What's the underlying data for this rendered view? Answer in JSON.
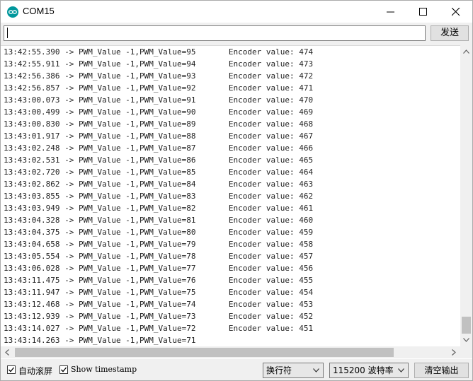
{
  "window": {
    "title": "COM15"
  },
  "send": {
    "input_value": "",
    "button_label": "发送"
  },
  "log_lines": [
    "13:42:55.390 -> PWM_Value -1,PWM_Value=95       Encoder value: 474",
    "13:42:55.911 -> PWM_Value -1,PWM_Value=94       Encoder value: 473",
    "13:42:56.386 -> PWM_Value -1,PWM_Value=93       Encoder value: 472",
    "13:42:56.857 -> PWM_Value -1,PWM_Value=92       Encoder value: 471",
    "13:43:00.073 -> PWM_Value -1,PWM_Value=91       Encoder value: 470",
    "13:43:00.499 -> PWM_Value -1,PWM_Value=90       Encoder value: 469",
    "13:43:00.830 -> PWM_Value -1,PWM_Value=89       Encoder value: 468",
    "13:43:01.917 -> PWM_Value -1,PWM_Value=88       Encoder value: 467",
    "13:43:02.248 -> PWM_Value -1,PWM_Value=87       Encoder value: 466",
    "13:43:02.531 -> PWM_Value -1,PWM_Value=86       Encoder value: 465",
    "13:43:02.720 -> PWM_Value -1,PWM_Value=85       Encoder value: 464",
    "13:43:02.862 -> PWM_Value -1,PWM_Value=84       Encoder value: 463",
    "13:43:03.855 -> PWM_Value -1,PWM_Value=83       Encoder value: 462",
    "13:43:03.949 -> PWM_Value -1,PWM_Value=82       Encoder value: 461",
    "13:43:04.328 -> PWM_Value -1,PWM_Value=81       Encoder value: 460",
    "13:43:04.375 -> PWM_Value -1,PWM_Value=80       Encoder value: 459",
    "13:43:04.658 -> PWM_Value -1,PWM_Value=79       Encoder value: 458",
    "13:43:05.554 -> PWM_Value -1,PWM_Value=78       Encoder value: 457",
    "13:43:06.028 -> PWM_Value -1,PWM_Value=77       Encoder value: 456",
    "13:43:11.475 -> PWM_Value -1,PWM_Value=76       Encoder value: 455",
    "13:43:11.947 -> PWM_Value -1,PWM_Value=75       Encoder value: 454",
    "13:43:12.468 -> PWM_Value -1,PWM_Value=74       Encoder value: 453",
    "13:43:12.939 -> PWM_Value -1,PWM_Value=73       Encoder value: 452",
    "13:43:14.027 -> PWM_Value -1,PWM_Value=72       Encoder value: 451",
    "13:43:14.263 -> PWM_Value -1,PWM_Value=71"
  ],
  "status": {
    "autoscroll_label": "自动滚屏",
    "autoscroll_checked": true,
    "timestamp_label": "Show timestamp",
    "timestamp_checked": true,
    "line_ending": "换行符",
    "baud_rate": "115200 波特率",
    "clear_label": "清空输出"
  },
  "icons": {
    "app": "arduino-icon",
    "minimize": "minimize-icon",
    "maximize": "maximize-icon",
    "close": "close-icon"
  },
  "colors": {
    "app_icon": "#00979c",
    "text": "#1e1e1e"
  }
}
